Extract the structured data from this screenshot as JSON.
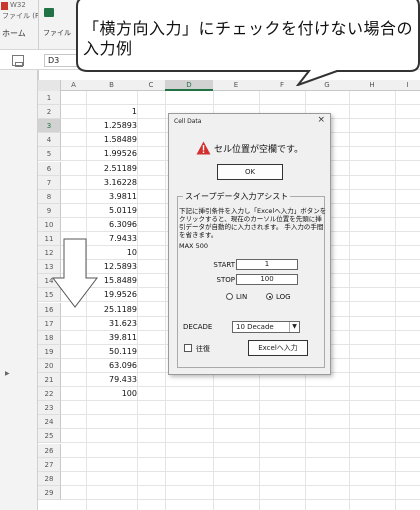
{
  "window": {
    "title_fragment": "W32",
    "file_fragment": "ファイル (F"
  },
  "ribbon": {
    "file_tab": "ファイル",
    "home_tab": "ホーム"
  },
  "formula_bar": {
    "name_box": "D3"
  },
  "columns": [
    "A",
    "B",
    "C",
    "D",
    "E",
    "F",
    "G",
    "H",
    "I"
  ],
  "selected_column": "D",
  "rows": [
    {
      "num": "1",
      "b": ""
    },
    {
      "num": "2",
      "b": "1"
    },
    {
      "num": "3",
      "b": "1.25893"
    },
    {
      "num": "4",
      "b": "1.58489"
    },
    {
      "num": "5",
      "b": "1.99526"
    },
    {
      "num": "6",
      "b": "2.51189"
    },
    {
      "num": "7",
      "b": "3.16228"
    },
    {
      "num": "8",
      "b": "3.9811"
    },
    {
      "num": "9",
      "b": "5.0119"
    },
    {
      "num": "10",
      "b": "6.3096"
    },
    {
      "num": "11",
      "b": "7.9433"
    },
    {
      "num": "12",
      "b": "10"
    },
    {
      "num": "13",
      "b": "12.5893"
    },
    {
      "num": "14",
      "b": "15.8489"
    },
    {
      "num": "15",
      "b": "19.9526"
    },
    {
      "num": "16",
      "b": "25.1189"
    },
    {
      "num": "17",
      "b": "31.623"
    },
    {
      "num": "18",
      "b": "39.811"
    },
    {
      "num": "19",
      "b": "50.119"
    },
    {
      "num": "20",
      "b": "63.096"
    },
    {
      "num": "21",
      "b": "79.433"
    },
    {
      "num": "22",
      "b": "100"
    },
    {
      "num": "23",
      "b": ""
    },
    {
      "num": "24",
      "b": ""
    },
    {
      "num": "25",
      "b": ""
    },
    {
      "num": "26",
      "b": ""
    },
    {
      "num": "27",
      "b": ""
    },
    {
      "num": "28",
      "b": ""
    },
    {
      "num": "29",
      "b": ""
    }
  ],
  "selected_row": "3",
  "callout": {
    "text": "「横方向入力」にチェックを付けない場合の入力例"
  },
  "dialog": {
    "title": "Cell Data",
    "close": "×",
    "warning_icon": "warning-triangle-icon",
    "message": "セル位置が空欄です。",
    "ok_label": "OK",
    "group_label": "スイープデータ入力アシスト",
    "description": "下記に挿引条件を入力し「Excelへ入力」ボタンをクリックすると、現在のカーソル位置を先頭に挿引データが自動的に入力されます。 手入力の手間を省きます。",
    "max": "MAX 500",
    "start_label": "START",
    "start_value": "1",
    "stop_label": "STOP",
    "stop_value": "100",
    "radio_lin": "LIN",
    "radio_log": "LOG",
    "radio_selected": "LOG",
    "decade_label": "DECADE",
    "decade_value": "10 Decade",
    "horizontal_label": "往復",
    "excel_button": "Excelへ入力"
  },
  "colors": {
    "excel_green": "#217346",
    "warning_red": "#d32f2f"
  }
}
